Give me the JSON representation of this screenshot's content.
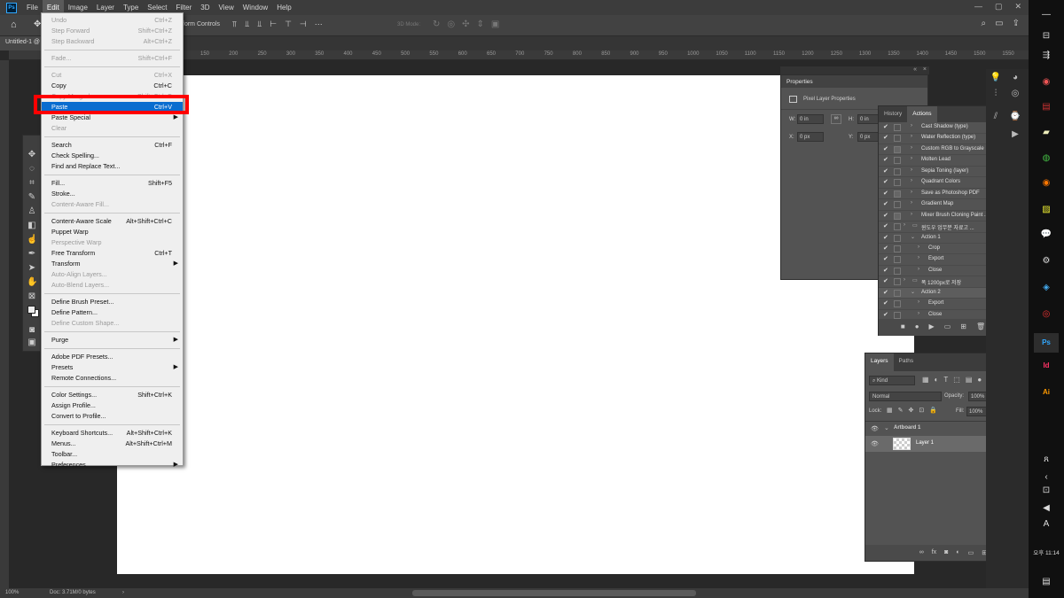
{
  "menubar": {
    "items": [
      "File",
      "Edit",
      "Image",
      "Layer",
      "Type",
      "Select",
      "Filter",
      "3D",
      "View",
      "Window",
      "Help"
    ],
    "active_index": 1
  },
  "optionsbar": {
    "transform_controls": "form Controls",
    "mode_3d": "3D Mode:"
  },
  "document": {
    "tab_title": "Untitled-1 @"
  },
  "ruler": {
    "ticks": [
      "150",
      "200",
      "250",
      "300",
      "350",
      "400",
      "450",
      "500",
      "550",
      "600",
      "650",
      "700",
      "750",
      "800",
      "850",
      "900",
      "950",
      "1000",
      "1050",
      "1100",
      "1150",
      "1200",
      "1250",
      "1300",
      "1350",
      "1400",
      "1450",
      "1500",
      "1550",
      "1600"
    ]
  },
  "edit_menu": {
    "highlighted": "Paste",
    "items": [
      {
        "label": "Undo",
        "shortcut": "Ctrl+Z",
        "disabled": true
      },
      {
        "label": "Step Forward",
        "shortcut": "Shift+Ctrl+Z",
        "disabled": true
      },
      {
        "label": "Step Backward",
        "shortcut": "Alt+Ctrl+Z",
        "disabled": true
      },
      {
        "sep": true
      },
      {
        "label": "Fade...",
        "shortcut": "Shift+Ctrl+F",
        "disabled": true
      },
      {
        "sep": true
      },
      {
        "label": "Cut",
        "shortcut": "Ctrl+X",
        "disabled": true
      },
      {
        "label": "Copy",
        "shortcut": "Ctrl+C",
        "disabled": false
      },
      {
        "label": "Copy Merged",
        "shortcut": "Shift+Ctrl+C",
        "disabled": true
      },
      {
        "label": "Paste",
        "shortcut": "Ctrl+V",
        "disabled": false
      },
      {
        "label": "Paste Special",
        "shortcut": "",
        "disabled": false,
        "submenu": true
      },
      {
        "label": "Clear",
        "shortcut": "",
        "disabled": true
      },
      {
        "sep": true
      },
      {
        "label": "Search",
        "shortcut": "Ctrl+F",
        "disabled": false
      },
      {
        "label": "Check Spelling...",
        "shortcut": "",
        "disabled": false
      },
      {
        "label": "Find and Replace Text...",
        "shortcut": "",
        "disabled": false
      },
      {
        "sep": true
      },
      {
        "label": "Fill...",
        "shortcut": "Shift+F5",
        "disabled": false
      },
      {
        "label": "Stroke...",
        "shortcut": "",
        "disabled": false
      },
      {
        "label": "Content-Aware Fill...",
        "shortcut": "",
        "disabled": true
      },
      {
        "sep": true
      },
      {
        "label": "Content-Aware Scale",
        "shortcut": "Alt+Shift+Ctrl+C",
        "disabled": false
      },
      {
        "label": "Puppet Warp",
        "shortcut": "",
        "disabled": false
      },
      {
        "label": "Perspective Warp",
        "shortcut": "",
        "disabled": true
      },
      {
        "label": "Free Transform",
        "shortcut": "Ctrl+T",
        "disabled": false
      },
      {
        "label": "Transform",
        "shortcut": "",
        "disabled": false,
        "submenu": true
      },
      {
        "label": "Auto-Align Layers...",
        "shortcut": "",
        "disabled": true
      },
      {
        "label": "Auto-Blend Layers...",
        "shortcut": "",
        "disabled": true
      },
      {
        "sep": true
      },
      {
        "label": "Define Brush Preset...",
        "shortcut": "",
        "disabled": false
      },
      {
        "label": "Define Pattern...",
        "shortcut": "",
        "disabled": false
      },
      {
        "label": "Define Custom Shape...",
        "shortcut": "",
        "disabled": true
      },
      {
        "sep": true
      },
      {
        "label": "Purge",
        "shortcut": "",
        "disabled": false,
        "submenu": true
      },
      {
        "sep": true
      },
      {
        "label": "Adobe PDF Presets...",
        "shortcut": "",
        "disabled": false
      },
      {
        "label": "Presets",
        "shortcut": "",
        "disabled": false,
        "submenu": true
      },
      {
        "label": "Remote Connections...",
        "shortcut": "",
        "disabled": false
      },
      {
        "sep": true
      },
      {
        "label": "Color Settings...",
        "shortcut": "Shift+Ctrl+K",
        "disabled": false
      },
      {
        "label": "Assign Profile...",
        "shortcut": "",
        "disabled": false
      },
      {
        "label": "Convert to Profile...",
        "shortcut": "",
        "disabled": false
      },
      {
        "sep": true
      },
      {
        "label": "Keyboard Shortcuts...",
        "shortcut": "Alt+Shift+Ctrl+K",
        "disabled": false
      },
      {
        "label": "Menus...",
        "shortcut": "Alt+Shift+Ctrl+M",
        "disabled": false
      },
      {
        "label": "Toolbar...",
        "shortcut": "",
        "disabled": false
      },
      {
        "label": "Preferences",
        "shortcut": "",
        "disabled": false,
        "submenu": true
      }
    ]
  },
  "properties": {
    "title": "Properties",
    "subtitle": "Pixel Layer Properties",
    "w_label": "W:",
    "w_value": "0 in",
    "h_label": "H:",
    "h_value": "0 in",
    "x_label": "X:",
    "x_value": "0 px",
    "y_label": "Y:",
    "y_value": "0 px"
  },
  "actions_panel": {
    "tabs": [
      "History",
      "Actions"
    ],
    "active_tab": "Actions",
    "rows": [
      {
        "label": "Cast Shadow (type)",
        "indent": 1,
        "box": false
      },
      {
        "label": "Water Reflection (type)",
        "indent": 1,
        "box": false
      },
      {
        "label": "Custom RGB to Grayscale",
        "indent": 1,
        "box": true
      },
      {
        "label": "Molten Lead",
        "indent": 1,
        "box": false
      },
      {
        "label": "Sepia Toning (layer)",
        "indent": 1,
        "box": false
      },
      {
        "label": "Quadrant Colors",
        "indent": 1,
        "box": false
      },
      {
        "label": "Save as Photoshop PDF",
        "indent": 1,
        "box": true
      },
      {
        "label": "Gradient Map",
        "indent": 1,
        "box": false
      },
      {
        "label": "Mixer Brush Cloning Paint ...",
        "indent": 1,
        "box": true
      },
      {
        "label": "윈도우 업무분 자료고 ...",
        "indent": 0,
        "box": false,
        "folder": true
      },
      {
        "label": "Action 1",
        "indent": 1,
        "box": false,
        "open": true
      },
      {
        "label": "Crop",
        "indent": 2,
        "box": false
      },
      {
        "label": "Export",
        "indent": 2,
        "box": false
      },
      {
        "label": "Close",
        "indent": 2,
        "box": false
      },
      {
        "label": "폭 1200px로 저장",
        "indent": 0,
        "box": false,
        "folder": true
      },
      {
        "label": "Action 2",
        "indent": 1,
        "box": false,
        "open": true,
        "selected": true
      },
      {
        "label": "Export",
        "indent": 2,
        "box": false
      },
      {
        "label": "Close",
        "indent": 2,
        "box": false
      }
    ]
  },
  "layers_panel": {
    "tabs": [
      "Layers",
      "Paths"
    ],
    "active_tab": "Layers",
    "filter_kind": "Kind",
    "blend_mode": "Normal",
    "opacity_label": "Opacity:",
    "opacity_value": "100%",
    "lock_label": "Lock:",
    "fill_label": "Fill:",
    "fill_value": "100%",
    "artboard": "Artboard 1",
    "layer": "Layer 1"
  },
  "statusbar": {
    "zoom": "100%",
    "doc": "Doc: 3.71M/0 bytes"
  },
  "taskbar": {
    "clock": "오후 11:14"
  },
  "colors": {
    "highlight": "#0a6dcf",
    "annotation_box": "#ff0000",
    "ps_blue": "#31a8ff"
  }
}
